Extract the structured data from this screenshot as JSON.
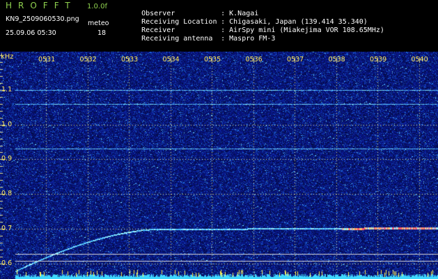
{
  "header": {
    "app_title": "HROFFT",
    "app_version": "1.0.0f",
    "file_name": "KN9_2509060530.png",
    "meteo_label": "meteo",
    "date_time": "25.09.06 05:30",
    "meteo_count": "18",
    "info": [
      {
        "label": "Observer",
        "value": ": K.Nagai"
      },
      {
        "label": "Receiving Location",
        "value": ": Chigasaki, Japan (139.414 35.340)"
      },
      {
        "label": "Receiver",
        "value": ": AirSpy mini (Miakejima VOR 108.65MHz)"
      },
      {
        "label": "Receiving antenna",
        "value": ": Maspro FM-3"
      }
    ]
  },
  "colors": {
    "background": "#000000",
    "plot_bg": "#0a1a78",
    "label": "#ffe95a",
    "title": "#8fd14f",
    "text": "#ffffff",
    "grid": "#ffff80"
  },
  "chart_data": {
    "type": "heatmap",
    "ylabel": "kHz",
    "x_ticks": [
      "0531",
      "0532",
      "0533",
      "0534",
      "0535",
      "0536",
      "0537",
      "0538",
      "0539",
      "0540"
    ],
    "y_ticks": [
      {
        "value": 1.1,
        "label": "1.1"
      },
      {
        "value": 1.0,
        "label": "1.0"
      },
      {
        "value": 0.9,
        "label": "0.9"
      },
      {
        "value": 0.8,
        "label": "0.8"
      },
      {
        "value": 0.7,
        "label": "0.7"
      },
      {
        "value": 0.6,
        "label": "0.6"
      }
    ],
    "x_range": [
      0,
      10
    ],
    "y_range": [
      0.58,
      1.2
    ],
    "grid": true,
    "horizontal_lines_khz": [
      1.1,
      1.06,
      0.93
    ],
    "carrier_khz": 0.705,
    "reference_lines_khz": [
      0.62,
      0.6
    ]
  }
}
